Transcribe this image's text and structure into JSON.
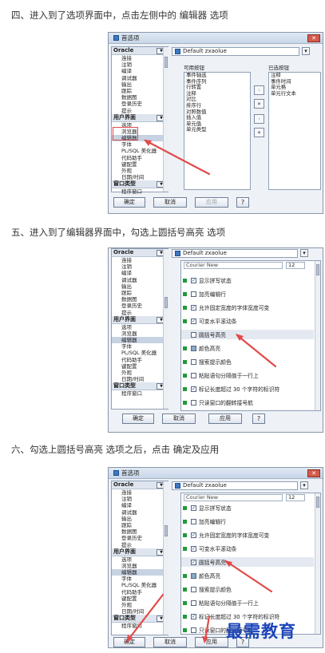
{
  "steps": [
    {
      "heading": "四、进入到了选项界面中，点击左侧中的 编辑器 选项"
    },
    {
      "heading": "五、进入到了编辑器界面中，勾选上圆括号高亮 选项"
    },
    {
      "heading": "六、勾选上圆括号高亮 选项之后，点击 确定及应用"
    }
  ],
  "dialog": {
    "title": "首选项",
    "close_glyph": "✕",
    "profile": "Default zxaolue",
    "ok_label": "确定",
    "cancel_label": "取消",
    "apply_label": "应用",
    "help_glyph": "?"
  },
  "nav_shot1": {
    "group_oracle": "Oracle",
    "oracle_items": [
      "连接",
      "注销",
      "编译",
      "调试器",
      "输出",
      "跟踪",
      "数据图",
      "登录历史",
      "提示"
    ],
    "group_ui": "用户界面",
    "ui_items": [
      "选项",
      "浏览器",
      "编辑器",
      "字体",
      "PL/SQL 美化器",
      "代码助手",
      "键配置",
      "外观",
      "日期/时间"
    ],
    "group_window": "窗口类型",
    "window_items": [
      "程序窗口"
    ],
    "selected_item": "编辑器"
  },
  "nav_shot23": {
    "group_oracle": "Oracle",
    "oracle_items": [
      "连接",
      "注销",
      "编译",
      "调试器",
      "输出",
      "跟踪",
      "数据图",
      "登录历史",
      "提示"
    ],
    "group_ui": "用户界面",
    "ui_items": [
      "选项",
      "浏览器",
      "编辑器",
      "字体",
      "PL/SQL 美化器",
      "代码助手",
      "键配置",
      "外观",
      "日期/时间"
    ],
    "group_window": "窗口类型",
    "window_items": [
      "程序窗口"
    ],
    "selected_item": "编辑器"
  },
  "shot1_lists": {
    "available_caption": "可用按钮",
    "available_items": [
      "事件轴选",
      "事件序列",
      "行转置",
      "注释",
      "对比",
      "排序行",
      "对照数值",
      "插入值",
      "单元值",
      "单元类型"
    ],
    "selected_caption": "已选按钮",
    "selected_items": [
      "注释",
      "事件时间",
      "单元格",
      "单元行文本"
    ],
    "move_right": "›",
    "move_all_right": "»",
    "move_left": "‹",
    "move_all_left": "«"
  },
  "editor_settings": {
    "font_name": "Courier New",
    "font_size": "12",
    "options": [
      {
        "label": "显示拼写状态",
        "checked": true
      },
      {
        "label": "加亮编辑行",
        "checked": false
      },
      {
        "label": "允许固定宽度的字体宽度可变",
        "checked": true
      },
      {
        "label": "可变水平滚动条",
        "checked": true
      },
      {
        "label": "圆括号高亮",
        "checked": false
      },
      {
        "label": "颜色高亮",
        "swatch": true
      },
      {
        "label": "搜索提示颜色",
        "checked": false
      },
      {
        "label": "粘贴语句分隔值于一行上",
        "checked": false
      },
      {
        "label": "标记长度超过 30 个字符的标识符",
        "checked": true
      },
      {
        "label": "只读窗口的翻转接号航",
        "checked": false
      }
    ],
    "options_after": [
      {
        "label": "显示拼写状态",
        "checked": true
      },
      {
        "label": "加亮编辑行",
        "checked": false
      },
      {
        "label": "允许固定宽度的字体宽度可变",
        "checked": true
      },
      {
        "label": "可变水平滚动条",
        "checked": true
      },
      {
        "label": "圆括号高亮",
        "checked": true
      },
      {
        "label": "颜色高亮",
        "swatch": true
      },
      {
        "label": "搜索提示颜色",
        "checked": false
      },
      {
        "label": "粘贴语句分隔值于一行上",
        "checked": false
      },
      {
        "label": "标记长度超过 30 个字符的标识符",
        "checked": true
      },
      {
        "label": "只读窗口的翻转接号航",
        "checked": false
      }
    ]
  },
  "watermark": "最需教育",
  "colors": {
    "annotation_red": "#e24a4a",
    "watermark_blue": "#1d46b8",
    "check_green": "#1f9a3a"
  },
  "icons": {
    "close": "close-icon",
    "dropdown": "chevron-down-icon",
    "check": "checkbox-icon",
    "help": "help-icon"
  }
}
